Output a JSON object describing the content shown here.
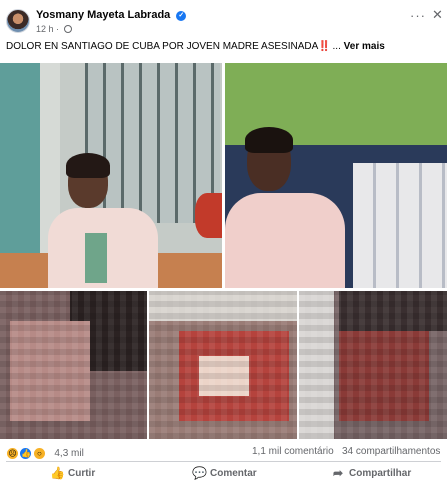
{
  "post": {
    "author": "Yosmany Mayeta Labrada",
    "time": "12 h",
    "separator": "·",
    "caption": "DOLOR EN SANTIAGO DE CUBA POR JOVEN MADRE ASESINADA",
    "caption_emoji": "‼️",
    "caption_ellipsis": "...",
    "see_more": "Ver mais"
  },
  "stats": {
    "reactions_count": "4,3 mil",
    "comments": "1,1 mil comentário",
    "shares": "34 compartilhamentos"
  },
  "actions": {
    "like": "Curtir",
    "comment": "Comentar",
    "share": "Compartilhar"
  },
  "icons": {
    "verified": "verified-badge-icon",
    "privacy": "globe-icon",
    "more": "more-options-icon",
    "close": "close-icon",
    "like": "thumbs-up-icon",
    "comment": "comment-bubble-icon",
    "share": "share-arrow-icon"
  },
  "colors": {
    "brand": "#1877f2",
    "secondary_text": "#65676b",
    "warning": "#e02020"
  }
}
